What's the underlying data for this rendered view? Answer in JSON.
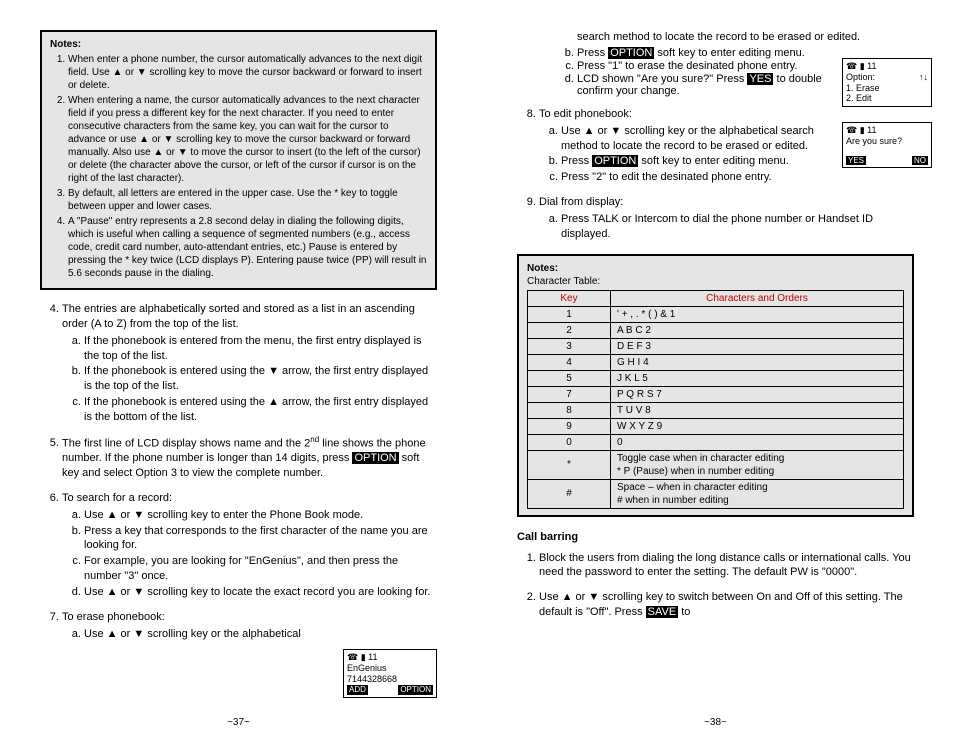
{
  "left": {
    "notes_title": "Notes:",
    "notes": [
      "When enter a phone number, the cursor automatically advances to the next digit field.  Use ▲ or ▼ scrolling key to move the cursor backward or forward to insert or delete.",
      "When entering a name, the cursor automatically advances to the next character field if you press a different key for the next character.  If you need to enter consecutive characters from the same key, you can wait for the cursor to advance or use ▲ or ▼ scrolling key to move the cursor backward or forward manually.  Also use ▲ or ▼ to move the cursor to insert (to the left of the cursor) or delete (the character above the cursor, or left of the cursor if cursor is on the right of the last character).",
      "By default, all letters are entered in the upper case.  Use the * key to toggle between upper and lower cases.",
      "A \"Pause\" entry represents a 2.8 second delay in dialing the following digits, which is useful when calling a sequence of segmented numbers (e.g., access code, credit card number, auto-attendant entries, etc.)  Pause is entered by pressing the * key twice (LCD displays P).  Entering pause twice (PP) will result in 5.6 seconds pause in the dialing."
    ],
    "item4": "The entries are alphabetically sorted and stored as a list in an ascending order (A to Z) from the top of the list.",
    "item4a": "If the phonebook is entered from the menu, the first entry displayed is the top of the list.",
    "item4b": "If the phonebook is entered using the ▼ arrow, the first entry displayed is the top of the list.",
    "item4c": "If the phonebook is entered using the ▲ arrow, the first entry displayed is the bottom of the list.",
    "item5_pre": "The first line of LCD display shows name and the 2",
    "item5_sup": "nd",
    "item5_post": " line shows the phone number.  If the phone number is longer than 14 digits, press ",
    "item5_option": "OPTION",
    "item5_end": " soft key and select Option 3 to view the complete number.",
    "item6": "To search for a record:",
    "item6a": "Use ▲ or ▼ scrolling key to enter the Phone Book mode.",
    "item6b": "Press a key that corresponds to the first character of the name you are looking for.",
    "item6c": "For example, you are looking for \"EnGenius\", and then press the number \"3\" once.",
    "item6d": "Use ▲ or ▼ scrolling key to locate the exact record you are looking for.",
    "item7": "To erase phonebook:",
    "item7a": "Use ▲ or ▼ scrolling key or the alphabetical",
    "lcd1": {
      "top": "☎ ▮ 11",
      "l1": "EnGenius",
      "l2": "7144328668",
      "b1": "ADD",
      "b2": "OPTION"
    },
    "page_num": "~37~"
  },
  "right": {
    "cont_line": "search method to locate the record to be erased or edited.",
    "r7b_pre": "Press ",
    "r7b_opt": "OPTION",
    "r7b_post": " soft key to enter editing menu.",
    "r7c": "Press \"1\" to erase the desinated phone entry.",
    "r7d_pre": "LCD shown \"Are you sure?\"  Press ",
    "r7d_yes": "YES",
    "r7d_post": " to double confirm your change.",
    "item8": "To edit phonebook:",
    "r8a": "Use ▲ or ▼ scrolling key or the alphabetical search method to locate the record to be erased or edited.",
    "r8b_pre": "Press ",
    "r8b_opt": "OPTION",
    "r8b_post": " soft key to enter editing menu.",
    "r8c": "Press \"2\" to edit the desinated phone entry.",
    "item9": "Dial from display:",
    "r9a": "Press TALK or Intercom to dial the phone number or Handset ID displayed.",
    "lcd2": {
      "top": "☎ ▮ 11",
      "l1": "Option:",
      "arrows": "↑↓",
      "l2": "1. Erase",
      "l3": "2. Edit"
    },
    "lcd3": {
      "top": "☎ ▮ 11",
      "l1": "Are you sure?",
      "b1": "YES",
      "b2": "NO"
    },
    "char_notes_title": "Notes:",
    "char_subtitle": "Character Table:",
    "char_head_key": "Key",
    "char_head_chars": "Characters and Orders",
    "char_rows": [
      {
        "k": "1",
        "v": "' + , . * ( ) & 1"
      },
      {
        "k": "2",
        "v": "A B C 2"
      },
      {
        "k": "3",
        "v": "D E F 3"
      },
      {
        "k": "4",
        "v": "G H I 4"
      },
      {
        "k": "5",
        "v": "J K L 5"
      },
      {
        "k": "7",
        "v": "P Q R S 7"
      },
      {
        "k": "8",
        "v": "T U V 8"
      },
      {
        "k": "9",
        "v": "W X Y Z 9"
      },
      {
        "k": "0",
        "v": "0"
      },
      {
        "k": "*",
        "v": "Toggle case when in character editing\n* P (Pause) when in number editing"
      },
      {
        "k": "#",
        "v": "Space – when in character editing\n# when in number editing"
      }
    ],
    "call_barring_title": "Call barring",
    "cb1": "Block the users from dialing the long distance calls or international calls. You need the password to enter the setting. The default PW is \"0000\".",
    "cb2_pre": "Use ▲ or ▼ scrolling key to switch between On and Off of this setting. The default is \"Off\". Press ",
    "cb2_save": "SAVE",
    "cb2_post": " to",
    "page_num": "~38~"
  }
}
